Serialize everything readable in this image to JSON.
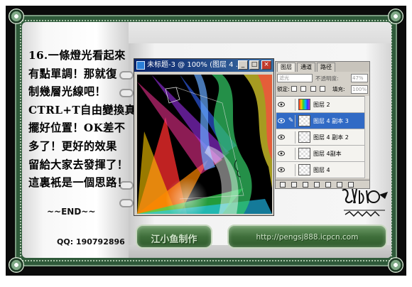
{
  "tutorial": {
    "lines": [
      "16.一條燈光看起來",
      "有點單調！那就復",
      "制幾層光線吧！",
      "CTRL+T自由變換真",
      "擺好位置！OK差不",
      "多了！更好的效果",
      "留給大家去發揮了！",
      "這裏衹是一個思路！"
    ],
    "end": "~~END~~",
    "qq": "QQ: 190792896"
  },
  "ps_window": {
    "title": "未标题-3 @ 100% (图层 4 ...",
    "min_glyph": "_",
    "max_glyph": "□",
    "close_glyph": "×"
  },
  "layers_panel": {
    "tabs": [
      "图层",
      "通道",
      "路径"
    ],
    "blend_mode": "滤光",
    "opacity_label": "不透明度:",
    "opacity_value": "47%",
    "lock_label": "锁定:",
    "fill_label": "填充:",
    "fill_value": "100%",
    "layers": [
      {
        "name": "图层 2",
        "selected": false,
        "thumb": "rainbow"
      },
      {
        "name": "图层 4 副本 3",
        "selected": true,
        "thumb": "transparent"
      },
      {
        "name": "图层 4 副本 2",
        "selected": false,
        "thumb": "transparent"
      },
      {
        "name": "图层 4副本",
        "selected": false,
        "thumb": "transparent"
      },
      {
        "name": "图层 4",
        "selected": false,
        "thumb": "transparent"
      }
    ]
  },
  "buttons": {
    "author_label": "江小鱼制作",
    "url_label": "http://pengsj888.icpcn.com"
  },
  "colors": {
    "frame": "#0b0b0b",
    "green_band": "#2f5a3a",
    "button_green": "#3f6f3b",
    "selection_blue": "#316ac5"
  }
}
